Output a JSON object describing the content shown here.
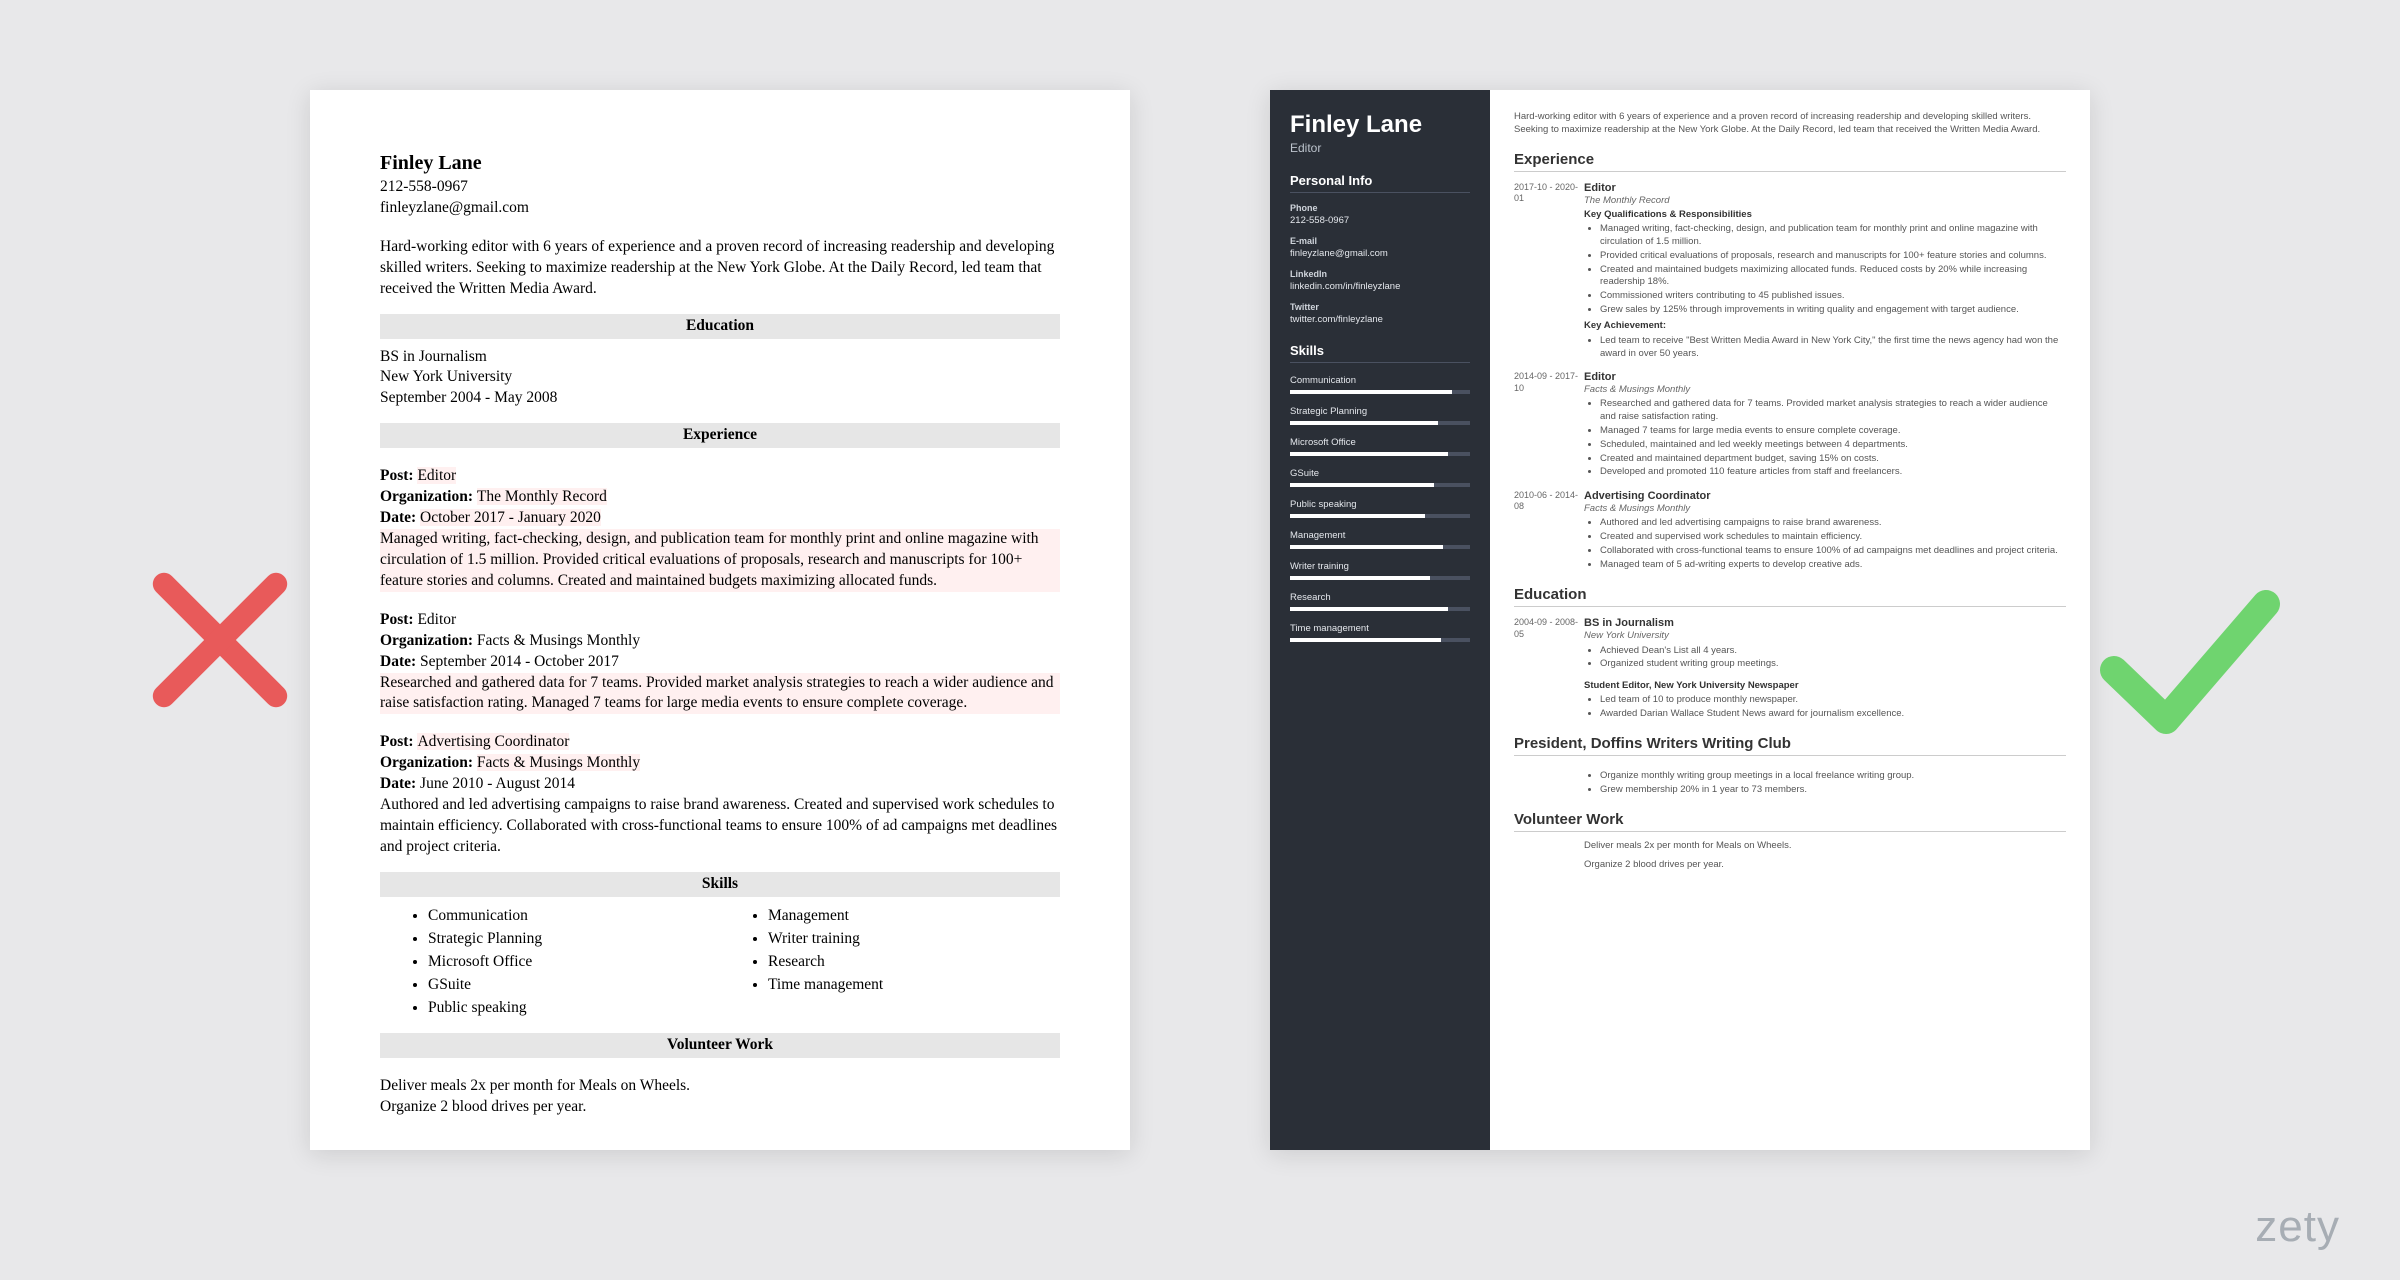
{
  "logo": "zety",
  "icons": {
    "bad": "x-icon",
    "good": "check-icon"
  },
  "left": {
    "name": "Finley Lane",
    "phone": "212-558-0967",
    "email": "finleyzlane@gmail.com",
    "summary": "Hard-working editor with 6 years of experience and a proven record of increasing readership and developing skilled writers. Seeking to maximize readership at the New York Globe. At the Daily Record, led team that received the Written Media Award.",
    "sections": {
      "education": "Education",
      "experience": "Experience",
      "skills": "Skills",
      "volunteer": "Volunteer Work"
    },
    "education": {
      "degree": "BS in Journalism",
      "school": "New York University",
      "dates": "September 2004 - May 2008"
    },
    "labels": {
      "post": "Post:",
      "org": "Organization:",
      "date": "Date:"
    },
    "exp": [
      {
        "post": "Editor",
        "org": "The Monthly Record",
        "date": "October 2017 - January 2020",
        "body": "Managed writing, fact-checking, design, and publication team for monthly print and online magazine with circulation of 1.5 million. Provided critical evaluations of proposals, research and manuscripts for 100+ feature stories and columns. Created and maintained budgets maximizing allocated funds."
      },
      {
        "post": "Editor",
        "org": "Facts & Musings Monthly",
        "date": "September 2014 - October 2017",
        "body": "Researched and gathered data for 7 teams. Provided market analysis strategies to reach a wider audience and raise satisfaction rating. Managed 7 teams for large media events to ensure complete coverage."
      },
      {
        "post": "Advertising Coordinator",
        "org": "Facts & Musings Monthly",
        "date": "June 2010 - August 2014",
        "body": "Authored and led advertising campaigns to raise brand awareness. Created and supervised work schedules to maintain efficiency. Collaborated with cross-functional teams to ensure 100% of ad campaigns met deadlines and project criteria."
      }
    ],
    "skills_left": [
      "Communication",
      "Strategic Planning",
      "Microsoft Office",
      "GSuite",
      "Public speaking"
    ],
    "skills_right": [
      "Management",
      "Writer training",
      "Research",
      "Time management"
    ],
    "volunteer": [
      "Deliver meals 2x per month for Meals on Wheels.",
      "Organize 2 blood drives per year."
    ]
  },
  "right": {
    "name": "Finley Lane",
    "title": "Editor",
    "side_headings": {
      "personal": "Personal Info",
      "skills": "Skills"
    },
    "personal": [
      {
        "label": "Phone",
        "value": "212-558-0967"
      },
      {
        "label": "E-mail",
        "value": "finleyzlane@gmail.com"
      },
      {
        "label": "LinkedIn",
        "value": "linkedin.com/in/finleyzlane"
      },
      {
        "label": "Twitter",
        "value": "twitter.com/finleyzlane"
      }
    ],
    "skills": [
      {
        "name": "Communication",
        "pct": 90
      },
      {
        "name": "Strategic Planning",
        "pct": 82
      },
      {
        "name": "Microsoft Office",
        "pct": 88
      },
      {
        "name": "GSuite",
        "pct": 80
      },
      {
        "name": "Public speaking",
        "pct": 75
      },
      {
        "name": "Management",
        "pct": 85
      },
      {
        "name": "Writer training",
        "pct": 78
      },
      {
        "name": "Research",
        "pct": 88
      },
      {
        "name": "Time management",
        "pct": 84
      }
    ],
    "summary": "Hard-working editor with 6 years of experience and a proven record of increasing readership and developing skilled writers. Seeking to maximize readership at the New York Globe. At the Daily Record, led team that received the Written Media Award.",
    "headings": {
      "experience": "Experience",
      "education": "Education",
      "club": "President, Doffins Writers Writing Club",
      "volunteer": "Volunteer Work"
    },
    "exp": [
      {
        "dates": "2017-10 - 2020-01",
        "title": "Editor",
        "org": "The Monthly Record",
        "sub1": "Key Qualifications & Responsibilities",
        "bullets1": [
          "Managed writing, fact-checking, design, and publication team for monthly print and online magazine with circulation of 1.5 million.",
          "Provided critical evaluations of proposals, research and manuscripts for 100+ feature stories and columns.",
          "Created and maintained budgets maximizing allocated funds. Reduced costs by 20% while increasing readership 18%.",
          "Commissioned writers contributing to 45 published issues.",
          "Grew sales by 125% through improvements in writing quality and engagement with target audience."
        ],
        "sub2": "Key Achievement:",
        "bullets2": [
          "Led team to receive \"Best Written Media Award in New York City,\" the first time the news agency had won the award in over 50 years."
        ]
      },
      {
        "dates": "2014-09 - 2017-10",
        "title": "Editor",
        "org": "Facts & Musings Monthly",
        "bullets1": [
          "Researched and gathered data for 7 teams. Provided market analysis strategies to reach a wider audience and raise satisfaction rating.",
          "Managed 7 teams for large media events to ensure complete coverage.",
          "Scheduled, maintained and led weekly meetings between 4 departments.",
          "Created and maintained department budget, saving 15% on costs.",
          "Developed and promoted 110 feature articles from staff and freelancers."
        ]
      },
      {
        "dates": "2010-06 - 2014-08",
        "title": "Advertising Coordinator",
        "org": "Facts & Musings Monthly",
        "bullets1": [
          "Authored and led advertising campaigns to raise brand awareness.",
          "Created and supervised work schedules to maintain efficiency.",
          "Collaborated with cross-functional teams to ensure 100% of ad campaigns met deadlines and project criteria.",
          "Managed team of 5 ad-writing experts to develop creative ads."
        ]
      }
    ],
    "edu": {
      "dates": "2004-09 - 2008-05",
      "title": "BS in Journalism",
      "org": "New York University",
      "bullets": [
        "Achieved Dean's List all 4 years.",
        "Organized student writing group meetings."
      ],
      "sub": "Student Editor, New York University Newspaper",
      "bullets2": [
        "Led team of 10 to produce monthly newspaper.",
        "Awarded Darian Wallace Student News award for journalism excellence."
      ]
    },
    "club": [
      "Organize monthly writing group meetings in a local freelance writing group.",
      "Grew membership 20% in 1 year to 73 members."
    ],
    "volunteer": [
      "Deliver meals 2x per month for Meals on Wheels.",
      "Organize 2 blood drives per year."
    ]
  }
}
